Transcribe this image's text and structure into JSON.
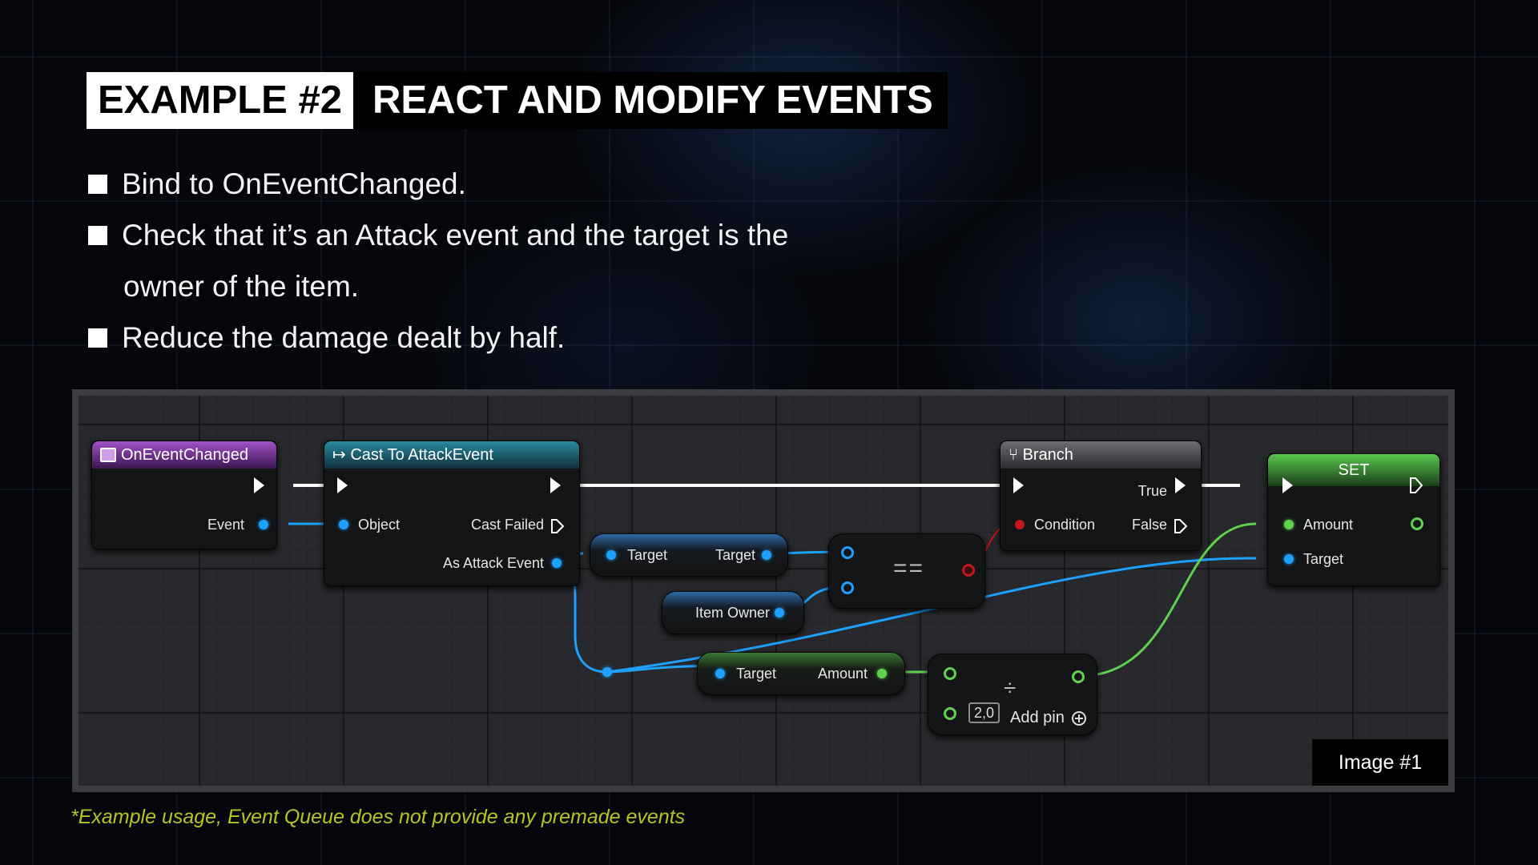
{
  "slide": {
    "tag": "EXAMPLE #2",
    "title": "REACT AND MODIFY EVENTS",
    "bullets": [
      "Bind to OnEventChanged.",
      "Check that it’s an Attack event and the target is the",
      "owner of the item.",
      "Reduce the damage dealt by half."
    ],
    "image_label": "Image #1",
    "footnote": "*Example usage, Event Queue does not provide any premade events"
  },
  "graph": {
    "nodes": {
      "on_event_changed": {
        "title": "OnEventChanged",
        "pins": {
          "event": "Event"
        }
      },
      "cast": {
        "title": "Cast To AttackEvent",
        "prefix_icon": "↦",
        "pins": {
          "object": "Object",
          "cast_failed": "Cast Failed",
          "as_attack_event": "As Attack Event"
        }
      },
      "get_target": {
        "in": "Target",
        "out": "Target"
      },
      "item_owner": {
        "label": "Item Owner"
      },
      "equals": {
        "op": "=="
      },
      "branch": {
        "title": "Branch",
        "pins": {
          "condition": "Condition",
          "true": "True",
          "false": "False"
        }
      },
      "set": {
        "title": "SET",
        "pins": {
          "amount": "Amount",
          "target": "Target"
        }
      },
      "get_amount": {
        "in": "Target",
        "out": "Amount"
      },
      "divide": {
        "op": "÷",
        "value": "2,0",
        "add_pin": "Add pin"
      }
    },
    "colors": {
      "exec_wire": "#ffffff",
      "object_wire": "#1ea0ff",
      "float_wire": "#5fd14f",
      "bool_wire": "#c4141c"
    }
  }
}
